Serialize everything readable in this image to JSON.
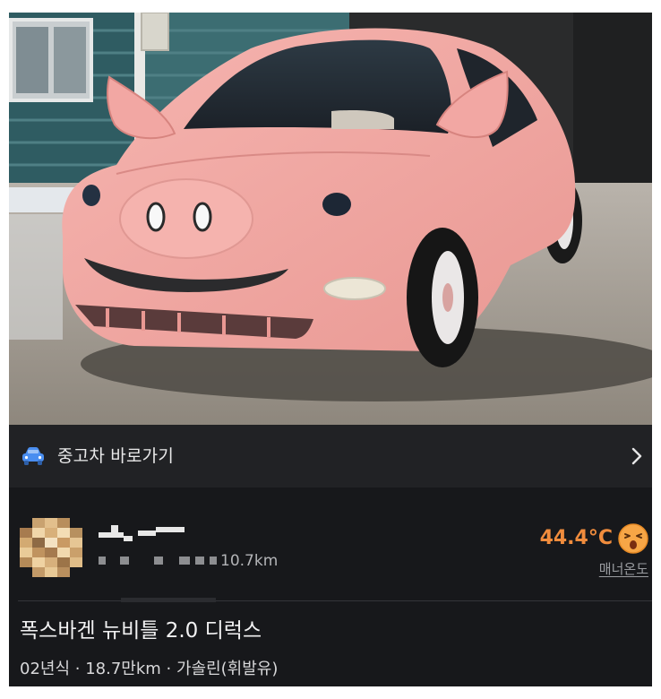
{
  "shortcut": {
    "icon": "car-icon",
    "label": "중고차 바로가기",
    "chevron": "chevron-right-icon"
  },
  "seller": {
    "avatar": "avatar-blurred",
    "nickname_blurred": true,
    "distance": "10.7km",
    "temperature": "44.4°C",
    "temperature_icon": "surprised-face-icon",
    "temperature_color": "#f08c3d",
    "manner_label": "매너온도"
  },
  "listing": {
    "title": "폭스바겐 뉴비틀 2.0 디럭스",
    "specs": "02년식 · 18.7만km · 가솔린(휘발유)"
  },
  "colors": {
    "background": "#17181b",
    "bar": "#212225",
    "accent": "#f08c3d",
    "car_icon": "#4a8ef0"
  }
}
